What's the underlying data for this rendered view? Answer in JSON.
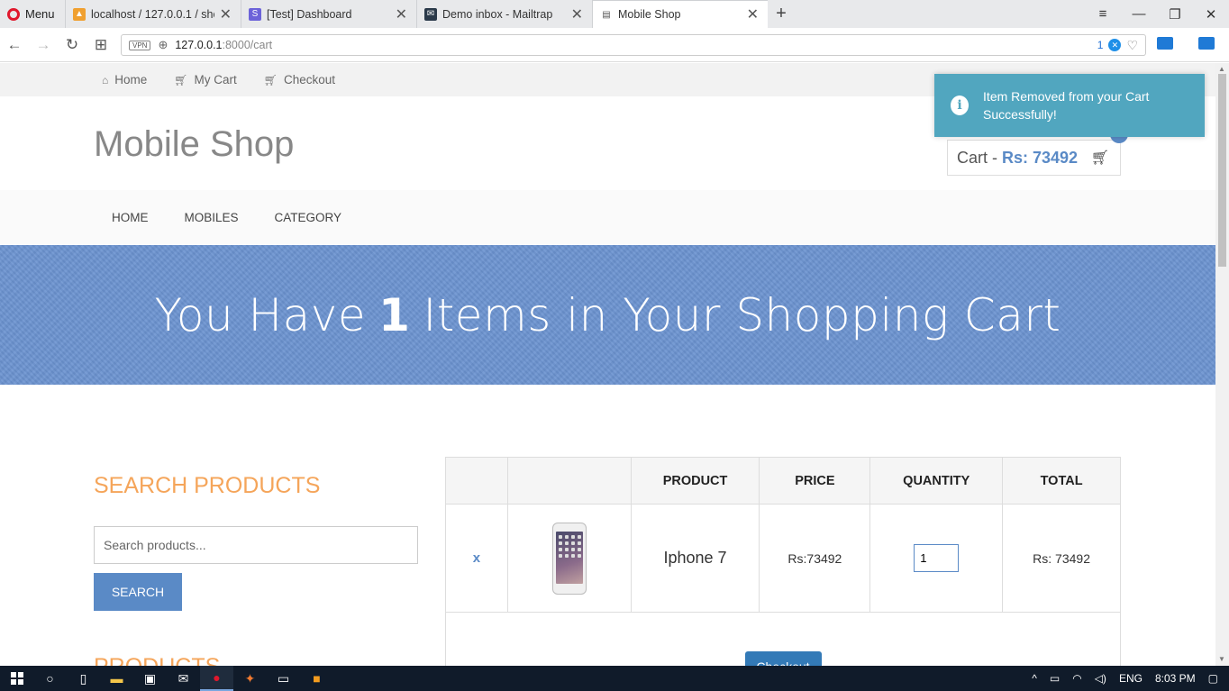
{
  "browser": {
    "menu_label": "Menu",
    "tabs": [
      {
        "title": "localhost / 127.0.0.1 / shop",
        "favicon": "phpmyadmin-icon"
      },
      {
        "title": "[Test] Dashboard",
        "favicon": "s-icon"
      },
      {
        "title": "Demo inbox - Mailtrap",
        "favicon": "mailtrap-icon"
      },
      {
        "title": "Mobile Shop",
        "favicon": "page-icon"
      }
    ],
    "url_host": "127.0.0.1",
    "url_path": ":8000/cart",
    "vpn_label": "VPN",
    "ext_count": "1"
  },
  "topbar": {
    "home": "Home",
    "my_cart": "My Cart",
    "checkout": "Checkout"
  },
  "site": {
    "title": "Mobile Shop",
    "cart_label": "Cart -",
    "cart_amount": "Rs: 73492",
    "cart_count": "1"
  },
  "nav": {
    "home": "HOME",
    "mobiles": "MOBILES",
    "category": "CATEGORY"
  },
  "banner": {
    "prefix": "You Have",
    "count": "1",
    "suffix": "Items in Your Shopping Cart"
  },
  "sidebar": {
    "search_heading": "SEARCH PRODUCTS",
    "search_placeholder": "Search products...",
    "search_button": "SEARCH",
    "products_heading": "PRODUCTS"
  },
  "cart_table": {
    "headers": [
      "",
      "",
      "PRODUCT",
      "PRICE",
      "QUANTITY",
      "TOTAL"
    ],
    "rows": [
      {
        "remove": "x",
        "product": "Iphone 7",
        "price": "Rs:73492",
        "quantity": "1",
        "total": "Rs: 73492"
      }
    ],
    "checkout_button": "Checkout"
  },
  "toast": {
    "message": "Item Removed from your Cart Successfully!"
  },
  "taskbar": {
    "lang": "ENG",
    "time": "8:03 PM"
  },
  "colors": {
    "accent": "#5a8ac6",
    "orange_heading": "#f5a55a",
    "toast": "#51a6bf",
    "banner": "#6b93d0"
  }
}
